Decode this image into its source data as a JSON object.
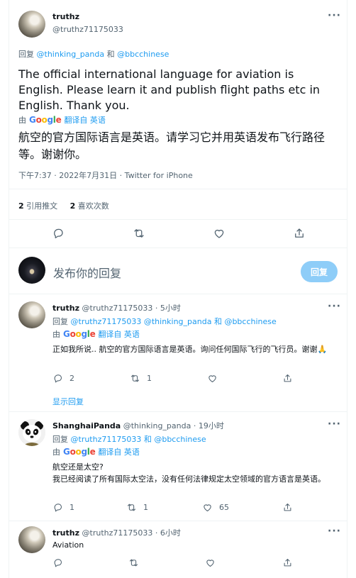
{
  "main_tweet": {
    "name": "truthz",
    "handle": "@truthz71175033",
    "reply_prefix": "回复",
    "reply_to": [
      "@thinking_panda",
      "@bbcchinese"
    ],
    "reply_and": "和",
    "text": "The official international language for aviation is English. Please learn it and publish flight paths etc in English. Thank you.",
    "translate_by": "由",
    "translate_label": "翻译自 英语",
    "translated_text": "航空的官方国际语言是英语。请学习它并用英语发布飞行路径等。谢谢你。",
    "meta": "下午7:37 · 2022年7月31日 · Twitter for iPhone",
    "retweets_count": "2",
    "retweets_label": "引用推文",
    "likes_count": "2",
    "likes_label": "喜欢次数"
  },
  "compose": {
    "placeholder": "发布你的回复",
    "button_label": "回复"
  },
  "replies": [
    {
      "name": "truthz",
      "handle_time": "@truthz71175033 · 5小时",
      "reply_prefix": "回复",
      "reply_to": "@truthz71175033 @thinking_panda 和 @bbcchinese",
      "translate_by": "由",
      "translate_label": "翻译自 英语",
      "text": "正如我所说.. 航空的官方国际语言是英语。询问任何国际飞行的飞行员。谢谢🙏",
      "reply_count": "2",
      "retweet_count": "1",
      "show_replies": "显示回复"
    },
    {
      "name": "ShanghaiPanda",
      "handle_time": "@thinking_panda · 19小时",
      "reply_prefix": "回复",
      "reply_to": "@truthz71175033 和 @bbcchinese",
      "translate_by": "由",
      "translate_label": "翻译自 英语",
      "text_line1": "航空还是太空?",
      "text_line2": "我已经阅读了所有国际太空法，没有任何法律规定太空领域的官方语言是英语。",
      "reply_count": "1",
      "retweet_count": "1",
      "like_count": "65"
    },
    {
      "name": "truthz",
      "handle_time": "@truthz71175033 · 6小时",
      "text": "Aviation"
    }
  ],
  "google_logo": "Google",
  "colors": {
    "accent": "#1d9bf0",
    "muted": "#536471",
    "button_disabled": "#8ecdf8"
  }
}
